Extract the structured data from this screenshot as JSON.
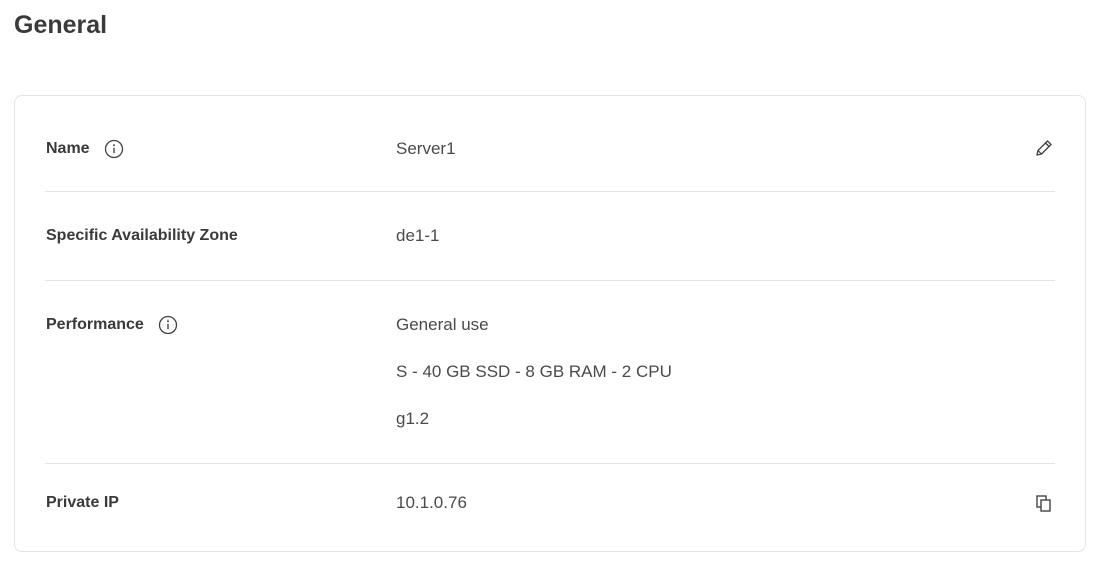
{
  "page": {
    "title": "General"
  },
  "rows": [
    {
      "label": "Name",
      "value": "Server1",
      "action_icon": "pencil-edit-icon",
      "has_info": true
    },
    {
      "label": "Specific Availability Zone",
      "value": "de1-1",
      "has_info": false
    },
    {
      "label": "Performance",
      "values": [
        "General use",
        "S - 40 GB SSD - 8 GB RAM - 2 CPU",
        "g1.2"
      ],
      "has_info": true
    },
    {
      "label": "Private IP",
      "value": "10.1.0.76",
      "action_icon": "copy-icon",
      "has_info": false
    }
  ],
  "colors": {
    "text_primary": "#3a3a3a",
    "text_value": "#4a4a4a",
    "divider": "#e4e4e4"
  }
}
